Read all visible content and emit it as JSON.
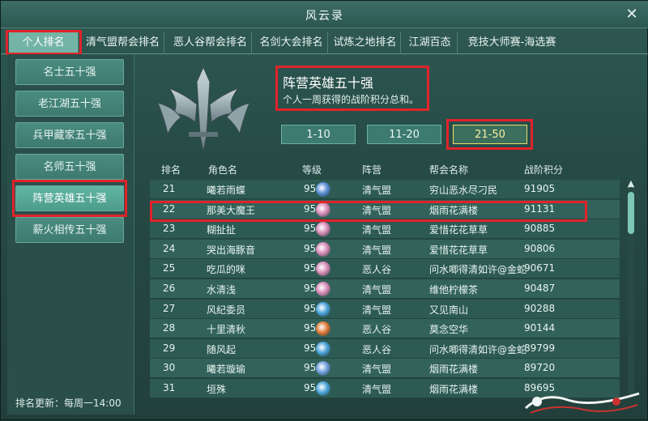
{
  "window": {
    "title": "风云录"
  },
  "tabs": [
    {
      "label": "个人排名"
    },
    {
      "label": "清气盟帮会排名"
    },
    {
      "label": "恶人谷帮会排名"
    },
    {
      "label": "名剑大会排名"
    },
    {
      "label": "试炼之地排名"
    },
    {
      "label": "江湖百态"
    },
    {
      "label": "竞技大师赛-海选赛"
    }
  ],
  "sidebar": {
    "items": [
      {
        "label": "名士五十强"
      },
      {
        "label": "老江湖五十强"
      },
      {
        "label": "兵甲藏家五十强"
      },
      {
        "label": "名师五十强"
      },
      {
        "label": "阵营英雄五十强"
      },
      {
        "label": "薪火相传五十强"
      }
    ],
    "update_text": "排名更新：每周一14:00"
  },
  "ranking": {
    "title": "阵营英雄五十强",
    "description": "个人一周获得的战阶积分总和。",
    "ranges": [
      {
        "label": "1-10"
      },
      {
        "label": "11-20"
      },
      {
        "label": "21-50"
      }
    ]
  },
  "table": {
    "headers": {
      "rank": "排名",
      "name": "角色名",
      "level": "等级",
      "camp": "阵营",
      "guild": "帮会名称",
      "score": "战阶积分"
    },
    "rows": [
      {
        "rank": "21",
        "name": "曦若雨蝶",
        "level": "95",
        "camp": "清气盟",
        "guild": "穷山恶水尽刁民",
        "score": "91905",
        "icon_color": "#5b8fd6"
      },
      {
        "rank": "22",
        "name": "那美大魔王",
        "level": "95",
        "camp": "清气盟",
        "guild": "烟雨花满楼",
        "score": "91131",
        "icon_color": "#d88bb7"
      },
      {
        "rank": "23",
        "name": "糊扯扯",
        "level": "95",
        "camp": "清气盟",
        "guild": "爱惜花花草草",
        "score": "90885",
        "icon_color": "#d88bb7"
      },
      {
        "rank": "24",
        "name": "哭出海豚音",
        "level": "95",
        "camp": "清气盟",
        "guild": "爱惜花花草草",
        "score": "90806",
        "icon_color": "#d88bb7"
      },
      {
        "rank": "25",
        "name": "吃瓜的咪",
        "level": "95",
        "camp": "恶人谷",
        "guild": "问水唧得清如许@金蛇",
        "score": "90671",
        "icon_color": "#d88bb7"
      },
      {
        "rank": "26",
        "name": "水清浅",
        "level": "95",
        "camp": "清气盟",
        "guild": "维他柠檬茶",
        "score": "90487",
        "icon_color": "#d88bb7"
      },
      {
        "rank": "27",
        "name": "风纪委员",
        "level": "95",
        "camp": "清气盟",
        "guild": "又见南山",
        "score": "90288",
        "icon_color": "#4aa3d8"
      },
      {
        "rank": "28",
        "name": "十里清秋",
        "level": "95",
        "camp": "恶人谷",
        "guild": "莫念空华",
        "score": "90144",
        "icon_color": "#e07a38"
      },
      {
        "rank": "29",
        "name": "随风起",
        "level": "95",
        "camp": "恶人谷",
        "guild": "问水唧得清如许@金蛇",
        "score": "89799",
        "icon_color": "#4aa3d8"
      },
      {
        "rank": "30",
        "name": "曦若璇瑜",
        "level": "95",
        "camp": "清气盟",
        "guild": "烟雨花满楼",
        "score": "89720",
        "icon_color": "#6f9fdc"
      },
      {
        "rank": "31",
        "name": "垣殊",
        "level": "95",
        "camp": "清气盟",
        "guild": "烟雨花满楼",
        "score": "89695",
        "icon_color": "#4aa3d8"
      }
    ]
  }
}
